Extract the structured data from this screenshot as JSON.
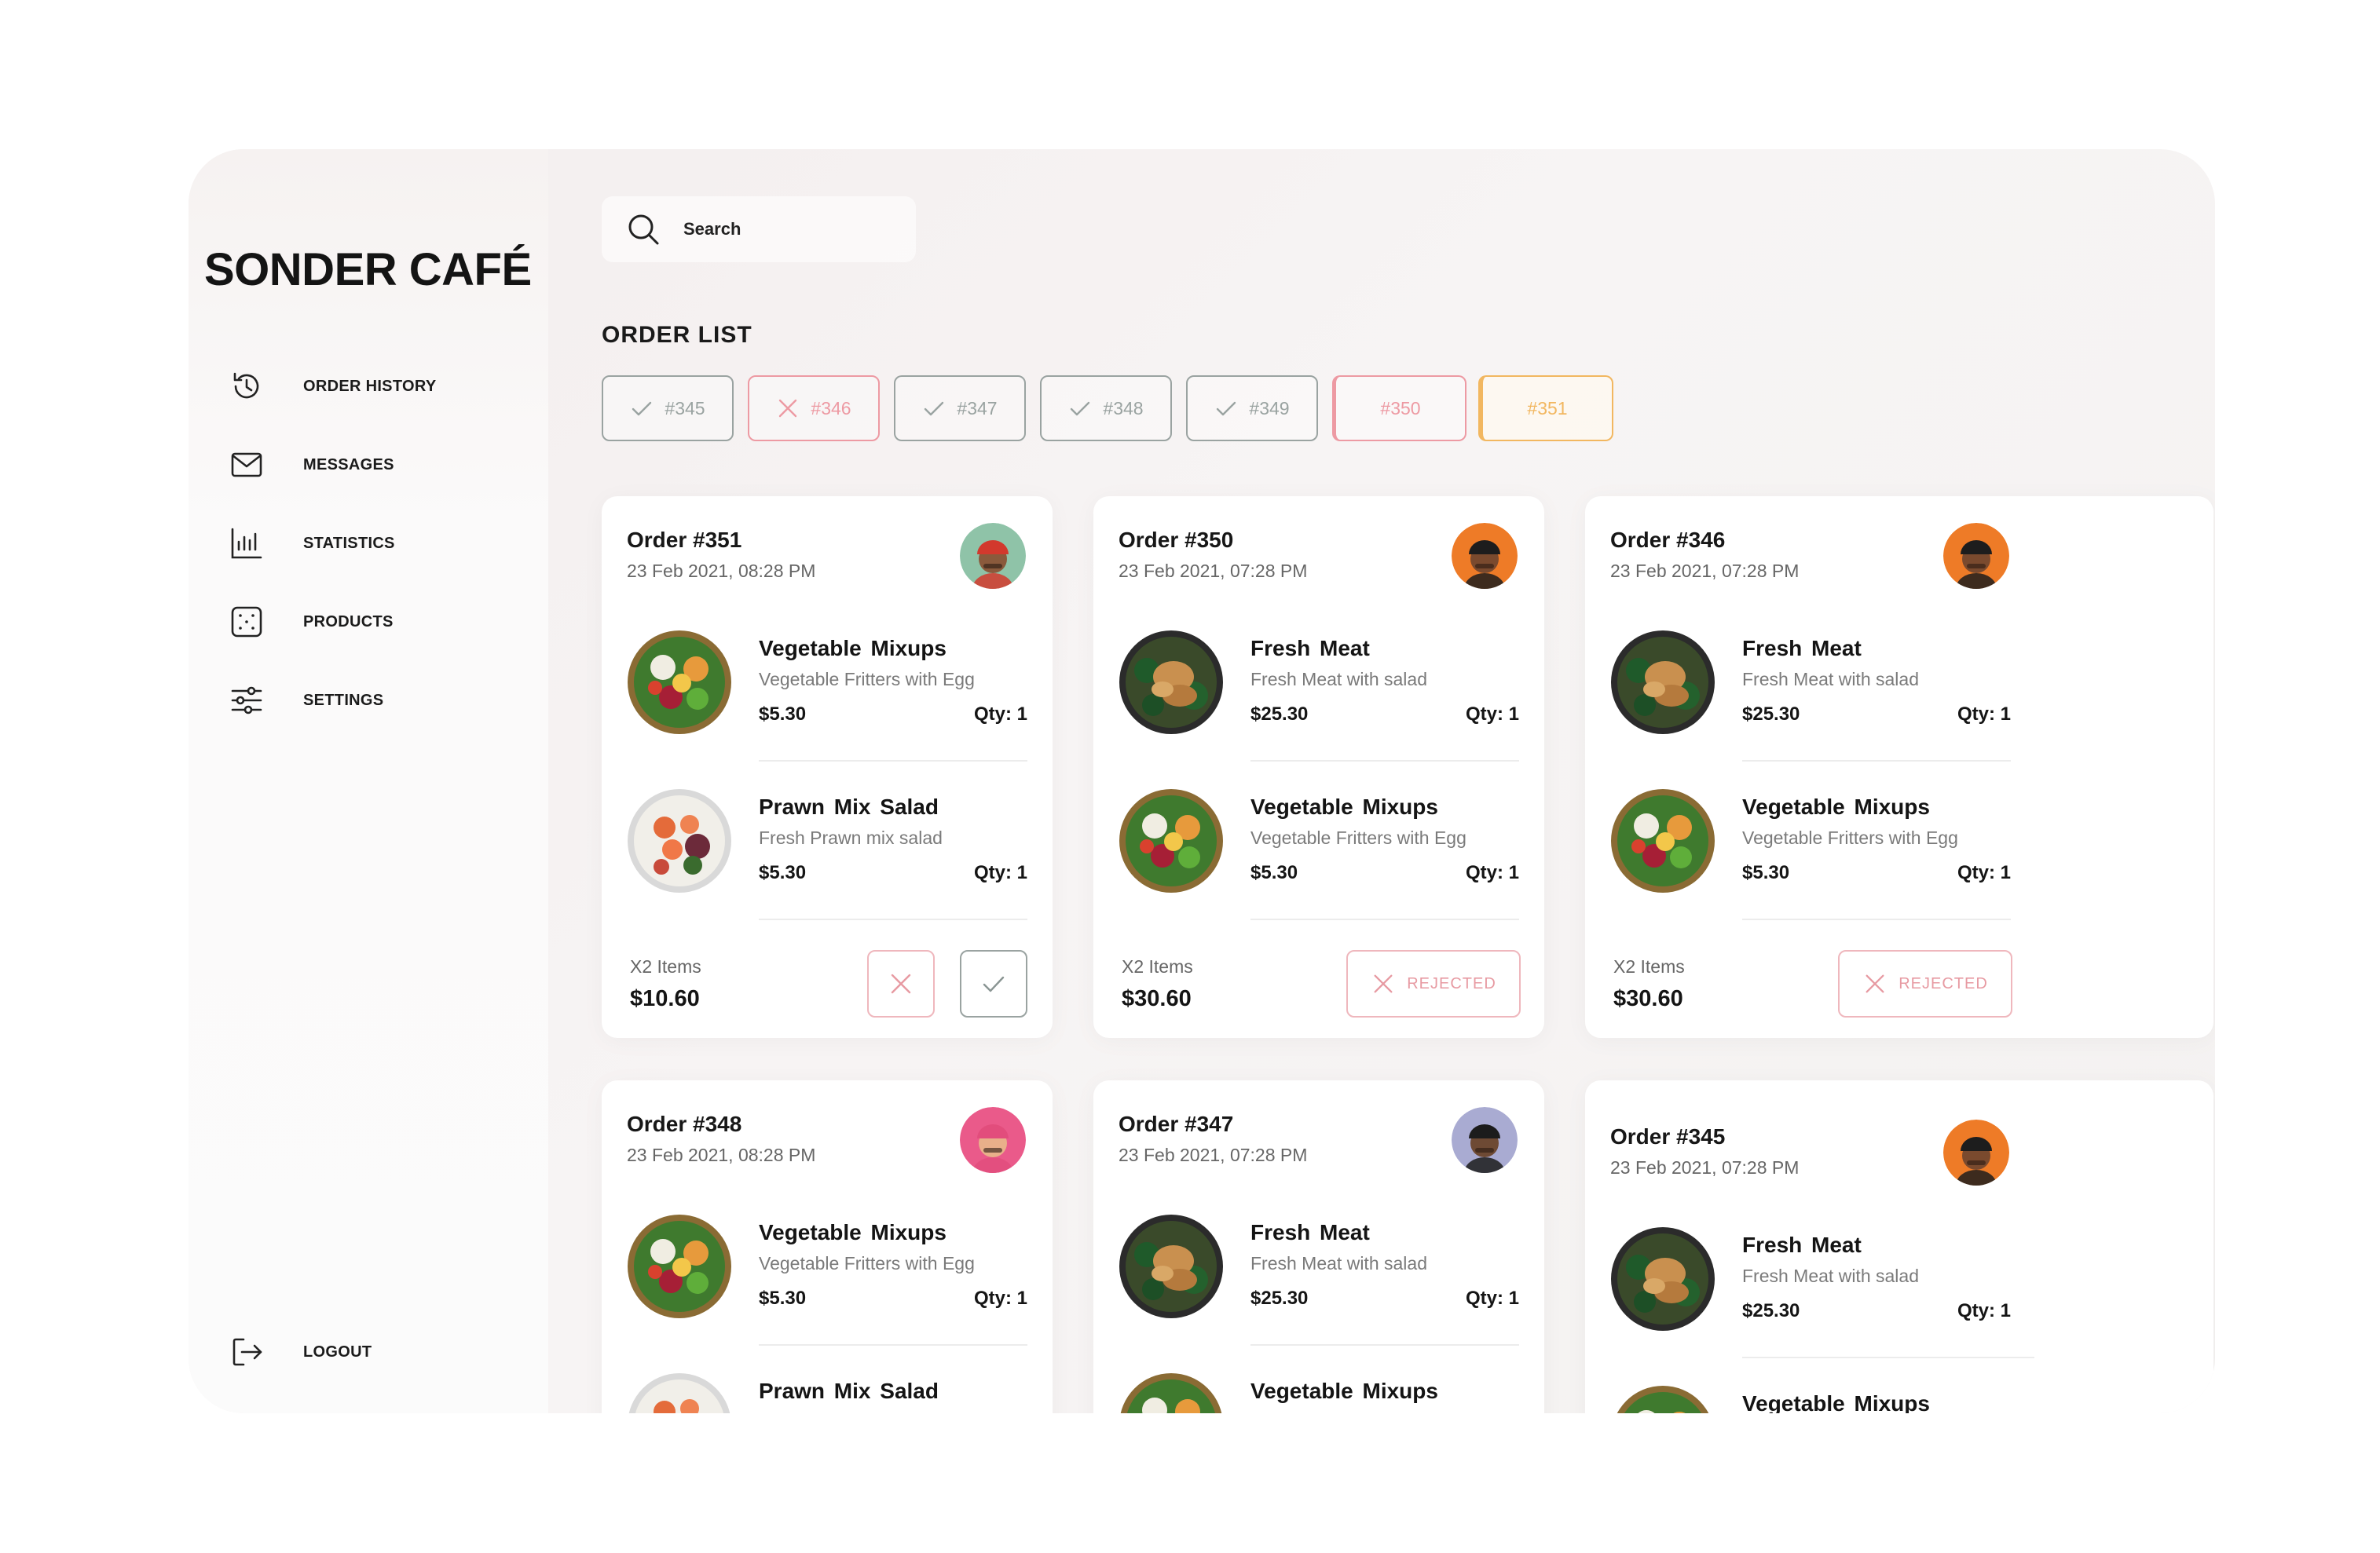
{
  "app": {
    "brand": "SONDER CAFÉ"
  },
  "nav": [
    {
      "label": "ORDER HISTORY",
      "icon": "history-icon"
    },
    {
      "label": "MESSAGES",
      "icon": "mail-icon"
    },
    {
      "label": "STATISTICS",
      "icon": "bar-chart-icon"
    },
    {
      "label": "PRODUCTS",
      "icon": "products-icon"
    },
    {
      "label": "SETTINGS",
      "icon": "sliders-icon"
    }
  ],
  "logout": {
    "label": "LOGOUT",
    "icon": "logout-icon"
  },
  "search": {
    "placeholder": "Search"
  },
  "order_list": {
    "title": "ORDER LIST",
    "chips": [
      {
        "label": "#345",
        "status": "accepted",
        "color": "#9aa3a1"
      },
      {
        "label": "#346",
        "status": "rejected",
        "color": "#ed9aa3"
      },
      {
        "label": "#347",
        "status": "accepted",
        "color": "#9aa3a1"
      },
      {
        "label": "#348",
        "status": "accepted",
        "color": "#9aa3a1"
      },
      {
        "label": "#349",
        "status": "accepted",
        "color": "#9aa3a1"
      },
      {
        "label": "#350",
        "status": "rejected",
        "color": "#ed9aa3"
      },
      {
        "label": "#351",
        "status": "pending",
        "color": "#f2b760"
      }
    ]
  },
  "orders": [
    {
      "title": "Order #351",
      "date": "23 Feb 2021, 08:28 PM",
      "avatar": "avatar-red-cap",
      "items": [
        {
          "name": "Vegetable  Mixups",
          "desc": "Vegetable Fritters with Egg",
          "price": "$5.30",
          "qty": "Qty: 1",
          "dish": "veg"
        },
        {
          "name": "Prawn Mix Salad",
          "desc": "Fresh Prawn mix salad",
          "price": "$5.30",
          "qty": "Qty: 1",
          "dish": "prawn"
        }
      ],
      "count": "X2 Items",
      "total": "$10.60",
      "state": "pending"
    },
    {
      "title": "Order #350",
      "date": "23 Feb 2021, 07:28 PM",
      "avatar": "avatar-orange",
      "items": [
        {
          "name": "Fresh Meat",
          "desc": "Fresh Meat with salad",
          "price": "$25.30",
          "qty": "Qty: 1",
          "dish": "meat"
        },
        {
          "name": "Vegetable  Mixups",
          "desc": "Vegetable Fritters with Egg",
          "price": "$5.30",
          "qty": "Qty: 1",
          "dish": "veg"
        }
      ],
      "count": "X2 Items",
      "total": "$30.60",
      "state": "rejected",
      "rejected_label": "REJECTED"
    },
    {
      "title": "Order #346",
      "date": "23 Feb 2021, 07:28 PM",
      "avatar": "avatar-orange",
      "items": [
        {
          "name": "Fresh Meat",
          "desc": "Fresh Meat with salad",
          "price": "$25.30",
          "qty": "Qty: 1",
          "dish": "meat"
        },
        {
          "name": "Vegetable  Mixups",
          "desc": "Vegetable Fritters with Egg",
          "price": "$5.30",
          "qty": "Qty: 1",
          "dish": "veg"
        }
      ],
      "count": "X2 Items",
      "total": "$30.60",
      "state": "rejected",
      "rejected_label": "REJECTED"
    },
    {
      "title": "Order #348",
      "date": "23 Feb 2021, 08:28 PM",
      "avatar": "avatar-pink",
      "items": [
        {
          "name": "Vegetable  Mixups",
          "desc": "Vegetable Fritters with Egg",
          "price": "$5.30",
          "qty": "Qty: 1",
          "dish": "veg"
        },
        {
          "name": "Prawn Mix Salad",
          "desc": "",
          "price": "",
          "qty": "",
          "dish": "prawn"
        }
      ]
    },
    {
      "title": "Order #347",
      "date": "23 Feb 2021, 07:28 PM",
      "avatar": "avatar-lavender",
      "items": [
        {
          "name": "Fresh Meat",
          "desc": "Fresh Meat with salad",
          "price": "$25.30",
          "qty": "Qty: 1",
          "dish": "meat"
        },
        {
          "name": "Vegetable  Mixups",
          "desc": "",
          "price": "",
          "qty": "",
          "dish": "veg"
        }
      ]
    },
    {
      "title": "Order #345",
      "date": "23 Feb 2021, 07:28 PM",
      "avatar": "avatar-orange",
      "items": [
        {
          "name": "Fresh Meat",
          "desc": "Fresh Meat with salad",
          "price": "$25.30",
          "qty": "Qty: 1",
          "dish": "meat"
        },
        {
          "name": "Vegetable  Mixups",
          "desc": "",
          "price": "",
          "qty": "",
          "dish": "veg"
        }
      ]
    }
  ],
  "colors": {
    "accept": "#9aa3a1",
    "reject": "#ed9aa3",
    "pending": "#f2b760"
  }
}
